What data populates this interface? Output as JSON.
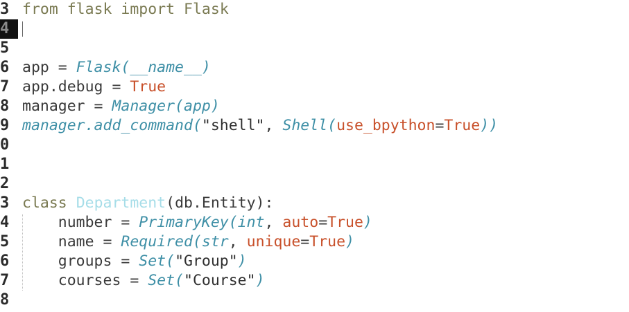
{
  "editor": {
    "lines": [
      {
        "num": "3",
        "tokens": [
          {
            "t": "from",
            "c": "kw"
          },
          {
            "t": " "
          },
          {
            "t": "flask",
            "c": "kw"
          },
          {
            "t": " "
          },
          {
            "t": "import",
            "c": "kw"
          },
          {
            "t": " "
          },
          {
            "t": "Flask",
            "c": "kw"
          }
        ]
      },
      {
        "num": "4",
        "current": true,
        "tokens": []
      },
      {
        "num": "5",
        "tokens": []
      },
      {
        "num": "6",
        "tokens": [
          {
            "t": "app = "
          },
          {
            "t": "Flask(__name__)",
            "c": "fn"
          }
        ]
      },
      {
        "num": "7",
        "tokens": [
          {
            "t": "app.debug = "
          },
          {
            "t": "True",
            "c": "lit"
          }
        ]
      },
      {
        "num": "8",
        "tokens": [
          {
            "t": "manager = "
          },
          {
            "t": "Manager(app)",
            "c": "fn"
          }
        ]
      },
      {
        "num": "9",
        "tokens": [
          {
            "t": "manager.add_command(",
            "c": "fn"
          },
          {
            "t": "\"shell\"",
            "c": "str"
          },
          {
            "t": ", "
          },
          {
            "t": "Shell(",
            "c": "fn"
          },
          {
            "t": "use_bpython",
            "c": "lit"
          },
          {
            "t": "="
          },
          {
            "t": "True",
            "c": "lit"
          },
          {
            "t": "))",
            "c": "fn"
          }
        ]
      },
      {
        "num": "0",
        "tokens": []
      },
      {
        "num": "1",
        "tokens": []
      },
      {
        "num": "2",
        "tokens": []
      },
      {
        "num": "3",
        "tokens": [
          {
            "t": "class",
            "c": "kw"
          },
          {
            "t": " "
          },
          {
            "t": "Department",
            "c": "cls"
          },
          {
            "t": "(db.Entity):"
          }
        ]
      },
      {
        "num": "4",
        "tokens": [
          {
            "t": "    number = "
          },
          {
            "t": "PrimaryKey(",
            "c": "fn"
          },
          {
            "t": "int",
            "c": "fn"
          },
          {
            "t": ", "
          },
          {
            "t": "auto",
            "c": "lit"
          },
          {
            "t": "="
          },
          {
            "t": "True",
            "c": "lit"
          },
          {
            "t": ")",
            "c": "fn"
          }
        ]
      },
      {
        "num": "5",
        "tokens": [
          {
            "t": "    name = "
          },
          {
            "t": "Required(",
            "c": "fn"
          },
          {
            "t": "str",
            "c": "fn"
          },
          {
            "t": ", "
          },
          {
            "t": "unique",
            "c": "lit"
          },
          {
            "t": "="
          },
          {
            "t": "True",
            "c": "lit"
          },
          {
            "t": ")",
            "c": "fn"
          }
        ]
      },
      {
        "num": "6",
        "tokens": [
          {
            "t": "    groups = "
          },
          {
            "t": "Set(",
            "c": "fn"
          },
          {
            "t": "\"Group\"",
            "c": "str"
          },
          {
            "t": ")",
            "c": "fn"
          }
        ]
      },
      {
        "num": "7",
        "tokens": [
          {
            "t": "    courses = "
          },
          {
            "t": "Set(",
            "c": "fn"
          },
          {
            "t": "\"Course\"",
            "c": "str"
          },
          {
            "t": ")",
            "c": "fn"
          }
        ]
      },
      {
        "num": "8",
        "tokens": []
      }
    ]
  }
}
